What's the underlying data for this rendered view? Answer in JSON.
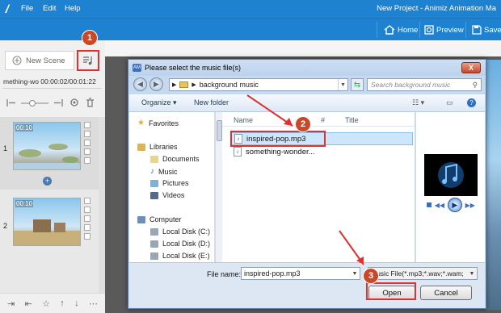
{
  "app": {
    "menu": [
      "File",
      "Edit",
      "Help"
    ],
    "title": "New Project - Animiz Animation Ma",
    "toolbar": {
      "home_label": "Home",
      "preview_label": "Preview",
      "save_label": "Save"
    }
  },
  "left_panel": {
    "new_scene_label": "New Scene",
    "music_row": "mething-wo 00:00:02/00:01:22",
    "scenes": [
      {
        "number": "1",
        "time": "00:10"
      },
      {
        "number": "2",
        "time": "00:10"
      }
    ],
    "add_scene_symbol": "+"
  },
  "dialog": {
    "title": "Please select the music file(s)",
    "close_symbol": "X",
    "address_path": "background music",
    "search_placeholder": "Search background music",
    "organize_label": "Organize",
    "new_folder_label": "New folder",
    "nav": {
      "favorites": "Favorites",
      "libraries": "Libraries",
      "library_items": [
        "Documents",
        "Music",
        "Pictures",
        "Videos"
      ],
      "computer": "Computer",
      "drives": [
        "Local Disk (C:)",
        "Local Disk (D:)",
        "Local Disk (E:)"
      ]
    },
    "columns": {
      "name": "Name",
      "number": "#",
      "title": "Title"
    },
    "files": [
      "inspired-pop.mp3",
      "something-wonder..."
    ],
    "file_name_label": "File name:",
    "file_name_value": "inspired-pop.mp3",
    "file_type_value": "Music File(*.mp3;*.wav;*.wam;",
    "open_label": "Open",
    "cancel_label": "Cancel"
  },
  "annotations": {
    "step1": "1",
    "step2": "2",
    "step3": "3",
    "highlight_color": "#e03030",
    "badge_color": "#c9482a"
  },
  "colors": {
    "app_blue": "#1e82d0"
  }
}
